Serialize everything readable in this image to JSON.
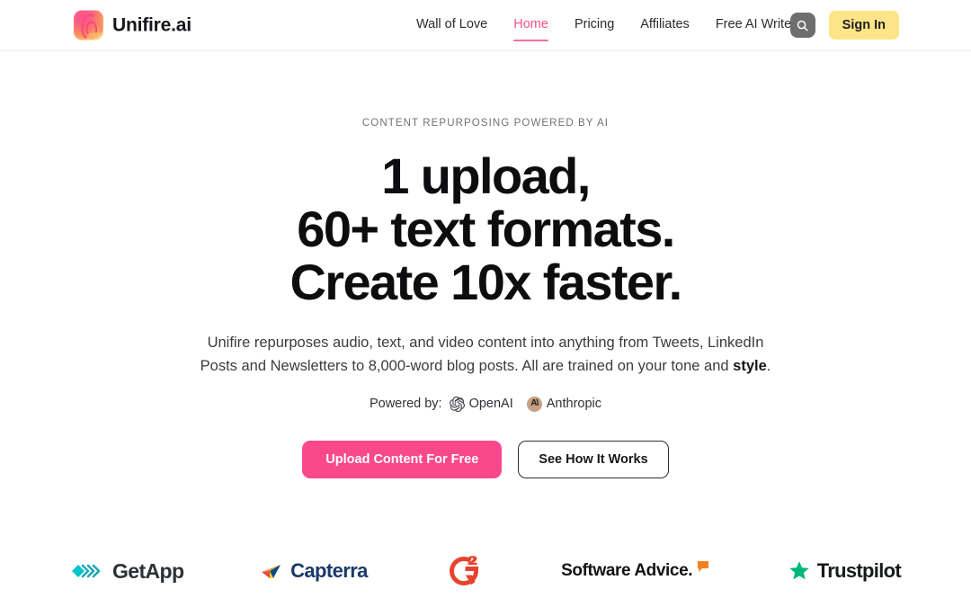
{
  "header": {
    "brand": {
      "name": "Unifire.ai",
      "logo_icon": "flame-swirl-icon"
    },
    "nav": [
      {
        "label": "Wall of Love",
        "active": false
      },
      {
        "label": "Home",
        "active": true
      },
      {
        "label": "Pricing",
        "active": false
      },
      {
        "label": "Affiliates",
        "active": false
      },
      {
        "label": "Free AI Writer",
        "active": false
      }
    ],
    "search_icon": "search-icon",
    "sign_in_label": "Sign In",
    "colors": {
      "accent_pink": "#f4508c",
      "signin_yellow": "#fce588",
      "search_gray": "#6e6e6e"
    }
  },
  "hero": {
    "eyebrow": "CONTENT REPURPOSING POWERED BY AI",
    "headline_lines": [
      "1 upload,",
      "60+ text formats.",
      "Create 10x faster."
    ],
    "subheadline": {
      "part1": "Unifire repurposes audio, text, and video content into anything from Tweets, LinkedIn Posts and Newsletters to 8,000-word blog posts. All are trained on your tone and ",
      "emphasis": "style",
      "part2": "."
    },
    "powered_by": {
      "label": "Powered by:",
      "providers": [
        {
          "name": "OpenAI",
          "icon": "openai-logo-icon"
        },
        {
          "name": "Anthropic",
          "icon": "anthropic-logo-icon",
          "mark_color": "#c7a185"
        }
      ]
    },
    "cta": {
      "primary_label": "Upload Content For Free",
      "primary_color": "#f9498c",
      "secondary_label": "See How It Works"
    }
  },
  "logo_bar": [
    {
      "name": "GetApp",
      "icon": "getapp-chevrons-icon",
      "color": "#2d3139"
    },
    {
      "name": "Capterra",
      "icon": "capterra-arrow-icon",
      "color": "#1a3a68"
    },
    {
      "name": "G2",
      "icon": "g2-logo-icon",
      "color": "#e8432f"
    },
    {
      "name": "Software Advice.",
      "icon": "software-advice-bubble-icon",
      "color": "#111315"
    },
    {
      "name": "Trustpilot",
      "icon": "trustpilot-star-icon",
      "color": "#00b67a"
    }
  ]
}
